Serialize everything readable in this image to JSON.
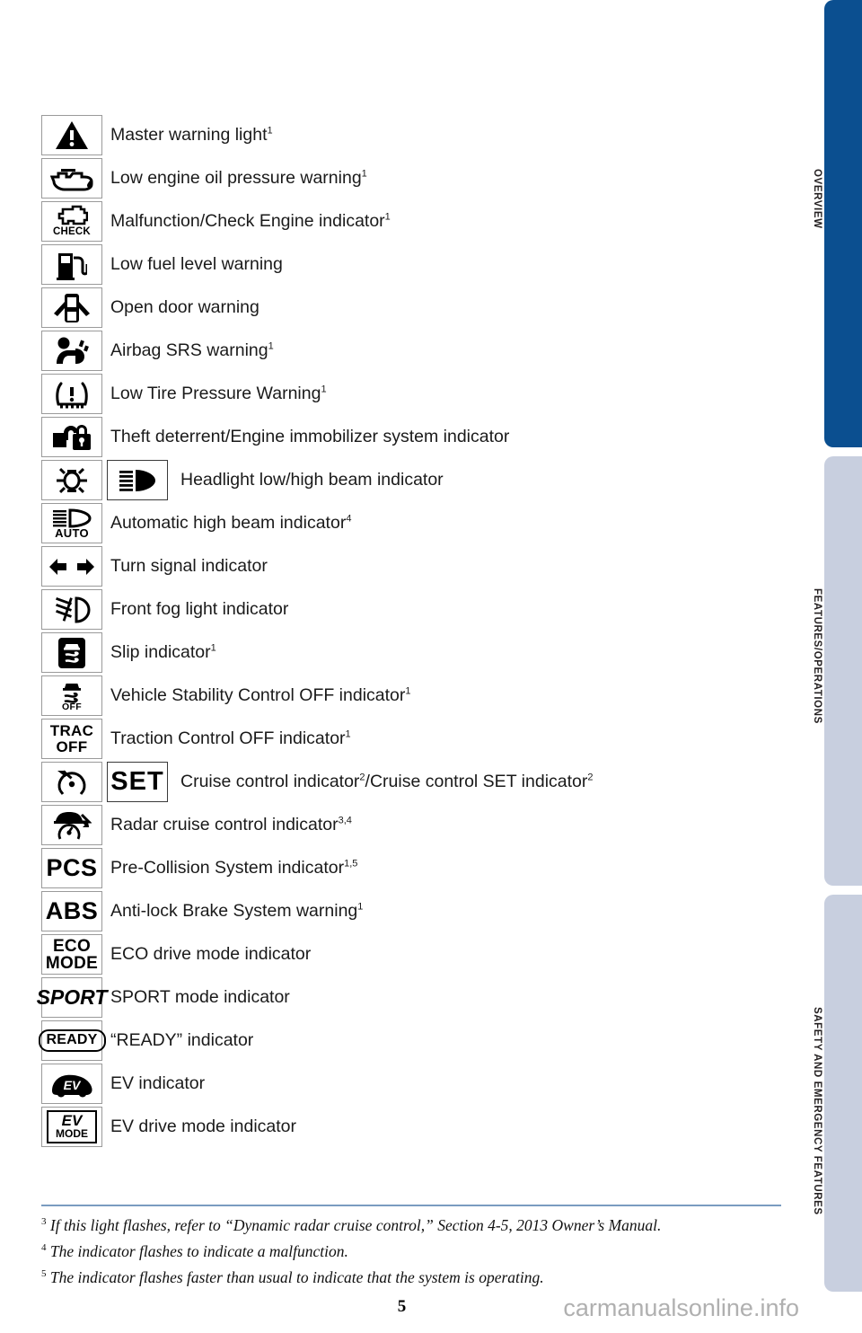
{
  "page": {
    "number": "5",
    "watermark": "carmanualsonline.info",
    "divider_color": "#7a9cc0"
  },
  "rail": {
    "active_color": "#0b4f90",
    "inactive_color": "#c8cfdf",
    "tabs": [
      {
        "label": "OVERVIEW",
        "state": "active"
      },
      {
        "label": "FEATURES/OPERATIONS",
        "state": "inactive"
      },
      {
        "label": "SAFETY AND EMERGENCY FEATURES",
        "state": "inactive"
      }
    ]
  },
  "indicators": [
    {
      "icon": "master-warning-triangle-icon",
      "label": "Master warning light",
      "sup": "1"
    },
    {
      "icon": "oil-can-icon",
      "label": "Low engine oil pressure warning",
      "sup": "1"
    },
    {
      "icon": "check-engine-icon",
      "glyph_text": "CHECK",
      "label": "Malfunction/Check Engine indicator",
      "sup": "1"
    },
    {
      "icon": "fuel-pump-icon",
      "label": "Low fuel level warning",
      "sup": ""
    },
    {
      "icon": "open-door-car-icon",
      "label": "Open door warning",
      "sup": ""
    },
    {
      "icon": "airbag-srs-icon",
      "label": "Airbag SRS warning",
      "sup": "1"
    },
    {
      "icon": "low-tire-pressure-icon",
      "label": "Low Tire Pressure Warning",
      "sup": "1"
    },
    {
      "icon": "theft-deterrent-key-lock-icon",
      "label": "Theft deterrent/Engine immobilizer system indicator",
      "sup": ""
    },
    {
      "icon": "headlight-low-beam-icon",
      "icon2": "headlight-high-beam-icon",
      "label": "Headlight low/high beam indicator",
      "sup": ""
    },
    {
      "icon": "automatic-high-beam-icon",
      "glyph_text": "AUTO",
      "label": "Automatic high beam indicator",
      "sup": "4"
    },
    {
      "icon": "turn-signal-arrows-icon",
      "label": "Turn signal indicator",
      "sup": ""
    },
    {
      "icon": "front-fog-light-icon",
      "label": "Front fog light indicator",
      "sup": ""
    },
    {
      "icon": "slip-indicator-icon",
      "label": "Slip indicator",
      "sup": "1"
    },
    {
      "icon": "vsc-off-icon",
      "glyph_text": "OFF",
      "label": "Vehicle Stability Control OFF indicator",
      "sup": "1"
    },
    {
      "icon": "trac-off-text-icon",
      "glyph_text": "TRAC OFF",
      "label": "Traction Control OFF indicator",
      "sup": "1"
    },
    {
      "icon": "cruise-control-icon",
      "icon2": "cruise-set-text-icon",
      "glyph_text2": "SET",
      "label": "Cruise control indicator²/Cruise control SET indicator",
      "sup": "2",
      "raw": true
    },
    {
      "icon": "radar-cruise-control-icon",
      "label": "Radar cruise control indicator",
      "sup": "3,4"
    },
    {
      "icon": "pcs-text-icon",
      "glyph_text": "PCS",
      "label": "Pre-Collision System indicator",
      "sup": "1,5"
    },
    {
      "icon": "abs-text-icon",
      "glyph_text": "ABS",
      "label": "Anti-lock Brake System warning",
      "sup": "1"
    },
    {
      "icon": "eco-mode-text-icon",
      "glyph_text": "ECO MODE",
      "label": "ECO drive mode indicator",
      "sup": ""
    },
    {
      "icon": "sport-text-icon",
      "glyph_text": "SPORT",
      "label": "SPORT mode indicator",
      "sup": ""
    },
    {
      "icon": "ready-text-icon",
      "glyph_text": "READY",
      "label": "“READY” indicator",
      "sup": ""
    },
    {
      "icon": "ev-car-icon",
      "glyph_text": "EV",
      "label": "EV indicator",
      "sup": ""
    },
    {
      "icon": "ev-mode-text-icon",
      "glyph_text": "EV MODE",
      "label": "EV drive mode indicator",
      "sup": ""
    }
  ],
  "labels": {
    "l0": "Master warning light",
    "s0": "1",
    "l1": "Low engine oil pressure warning",
    "s1": "1",
    "l2": "Malfunction/Check Engine indicator",
    "s2": "1",
    "l3": "Low fuel level warning",
    "s3": "",
    "l4": "Open door warning",
    "s4": "",
    "l5": "Airbag SRS warning",
    "s5": "1",
    "l6": "Low Tire Pressure Warning",
    "s6": "1",
    "l7": "Theft deterrent/Engine immobilizer system indicator",
    "s7": "",
    "l8": "Headlight low/high beam indicator",
    "s8": "",
    "l9": "Automatic high beam indicator",
    "s9": "4",
    "l10": "Turn signal indicator",
    "s10": "",
    "l11": "Front fog light indicator",
    "s11": "",
    "l12": "Slip indicator",
    "s12": "1",
    "l13": "Vehicle Stability Control OFF indicator",
    "s13": "1",
    "l14": "Traction Control OFF indicator",
    "s14": "1",
    "l15a": "Cruise control indicator",
    "s15a": "2",
    "l15b": "/Cruise control SET indicator",
    "s15b": "2",
    "l16": "Radar cruise control indicator",
    "s16": "3,4",
    "l17": "Pre-Collision System indicator",
    "s17": "1,5",
    "l18": "Anti-lock Brake System warning",
    "s18": "1",
    "l19": "ECO drive mode indicator",
    "s19": "",
    "l20": "SPORT mode indicator",
    "s20": "",
    "l21": "“READY” indicator",
    "s21": "",
    "l22": "EV indicator",
    "s22": "",
    "l23": "EV drive mode indicator",
    "s23": ""
  },
  "glyphs": {
    "check": "CHECK",
    "auto": "AUTO",
    "off": "OFF",
    "trac": "TRAC",
    "tracoff": "OFF",
    "set": "SET",
    "pcs": "PCS",
    "abs": "ABS",
    "eco": "ECO",
    "ecomode": "MODE",
    "sport": "SPORT",
    "ready": "READY",
    "ev": "EV",
    "evmode": "MODE"
  },
  "footnotes": [
    {
      "marker": "3",
      "text": "If this light flashes, refer to “Dynamic radar cruise control,” Section 4-5, 2013 Owner’s Manual."
    },
    {
      "marker": "4",
      "text": "The indicator flashes to indicate a malfunction."
    },
    {
      "marker": "5",
      "text": "The indicator flashes faster than usual to indicate that the system is operating."
    }
  ],
  "fn": {
    "m0": "3",
    "t0": "If this light flashes, refer to “Dynamic radar cruise control,” Section 4-5, 2013 Owner’s Manual.",
    "m1": "4",
    "t1": "The indicator flashes to indicate a malfunction.",
    "m2": "5",
    "t2": "The indicator flashes faster than usual to indicate that the system is operating."
  }
}
